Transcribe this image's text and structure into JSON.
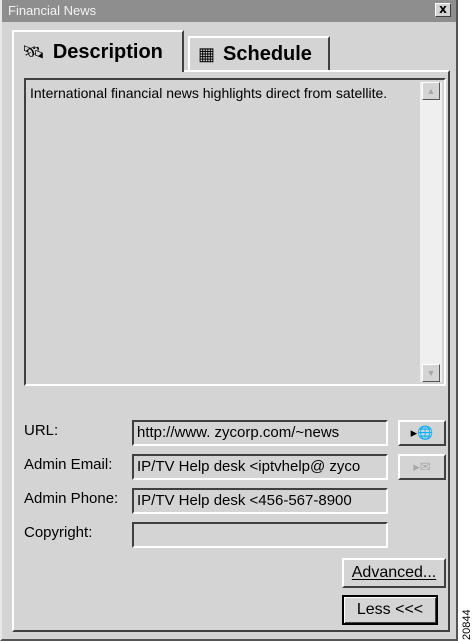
{
  "window": {
    "title": "Financial News",
    "close_label": "x"
  },
  "tabs": [
    {
      "label": "Description",
      "icon": "antenna-icon",
      "glyph": "🛰"
    },
    {
      "label": "Schedule",
      "icon": "calendar-icon",
      "glyph": "▦"
    }
  ],
  "description": {
    "text": "International financial news highlights direct from satellite."
  },
  "scrollbar": {
    "up": "▲",
    "down": "▼"
  },
  "fields": {
    "url": {
      "label": "URL:",
      "value": "http://www. zycorp.com/~news"
    },
    "admin_email": {
      "label": "Admin Email:",
      "value": "IP/TV Help desk <iptvhelp@ zyco"
    },
    "admin_phone": {
      "label": "Admin Phone:",
      "value": "IP/TV Help desk <456-567-8900"
    },
    "copyright": {
      "label": "Copyright:",
      "value": ""
    }
  },
  "actions": {
    "open_url": "▸🌐",
    "send_email": "▸✉"
  },
  "buttons": {
    "advanced": "Advanced...",
    "less": "Less <<<"
  },
  "figure_code": "20844"
}
